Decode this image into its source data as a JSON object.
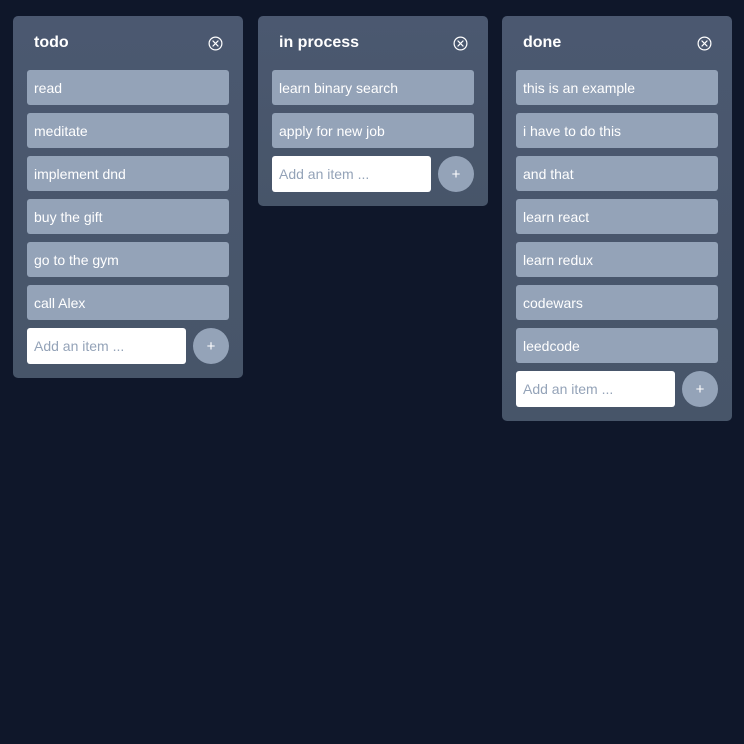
{
  "colors": {
    "background": "#0f172a",
    "column": "#475569",
    "card": "#94a3b8",
    "text": "#ffffff"
  },
  "columns": [
    {
      "title": "todo",
      "close_icon": "close-circle-icon",
      "items": [
        "read",
        "meditate",
        "implement dnd",
        "buy the gift",
        "go to the gym",
        "call Alex"
      ],
      "input_placeholder": "Add an item ...",
      "add_label": "+"
    },
    {
      "title": "in process",
      "close_icon": "close-circle-icon",
      "items": [
        "learn binary search",
        "apply for new job"
      ],
      "input_placeholder": "Add an item ...",
      "add_label": "+"
    },
    {
      "title": "done",
      "close_icon": "close-circle-icon",
      "items": [
        "this is an example",
        "i have to do this",
        "and that",
        "learn react",
        "learn redux",
        "codewars",
        "leedcode"
      ],
      "input_placeholder": "Add an item ...",
      "add_label": "+"
    }
  ]
}
